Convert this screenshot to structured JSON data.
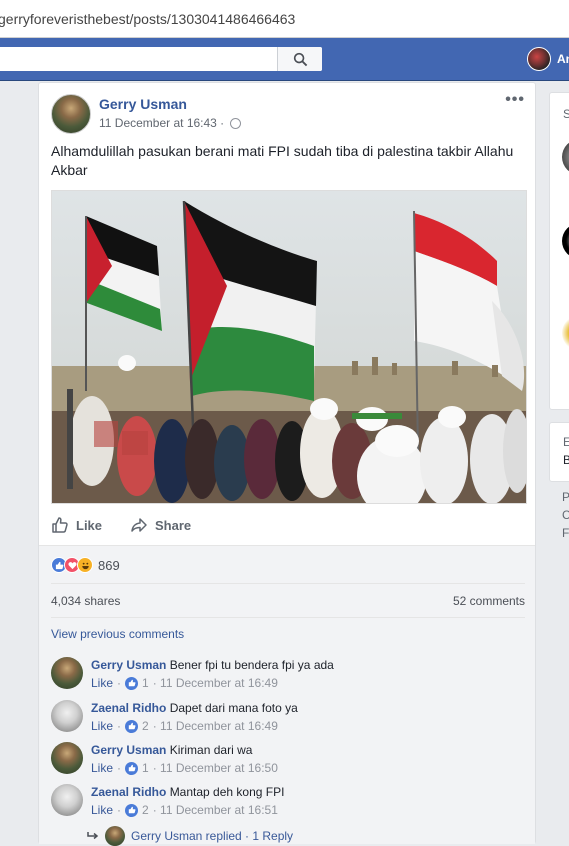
{
  "browser": {
    "url": "gerryforeveristhebest/posts/1303041486466463"
  },
  "topbar": {
    "user_name": "An",
    "search_placeholder": ""
  },
  "right_column": {
    "letters": [
      "S",
      "E",
      "B",
      "P",
      "C",
      "F"
    ]
  },
  "post": {
    "author": "Gerry Usman",
    "timestamp": "11 December at 16:43 ·",
    "text": "Alhamdulillah pasukan berani mati FPI sudah tiba di palestina takbir Allahu Akbar",
    "actions": {
      "like": "Like",
      "share": "Share"
    },
    "reactions_count": "869",
    "shares": "4,034 shares",
    "comments": "52 comments",
    "view_previous": "View previous comments"
  },
  "comment_list": [
    {
      "name": "Gerry Usman",
      "text": "Bener fpi tu bendera fpi ya ada",
      "like": "Like",
      "likes": "1",
      "time": "· 11 December at 16:49"
    },
    {
      "name": "Zaenal Ridho",
      "text": "Dapet dari mana foto ya",
      "like": "Like",
      "likes": "2",
      "time": "· 11 December at 16:49"
    },
    {
      "name": "Gerry Usman",
      "text": "Kiriman dari wa",
      "like": "Like",
      "likes": "1",
      "time": "· 11 December at 16:50"
    },
    {
      "name": "Zaenal Ridho",
      "text": "Mantap deh kong FPI",
      "like": "Like",
      "likes": "2",
      "time": "· 11 December at 16:51"
    }
  ],
  "replies_line": "Gerry Usman replied · 1 Reply",
  "colors": {
    "brand": "#4267b2",
    "link": "#365899",
    "like_blue": "#4a7bd8",
    "love_red": "#f25268",
    "haha_yellow": "#f7b125"
  }
}
